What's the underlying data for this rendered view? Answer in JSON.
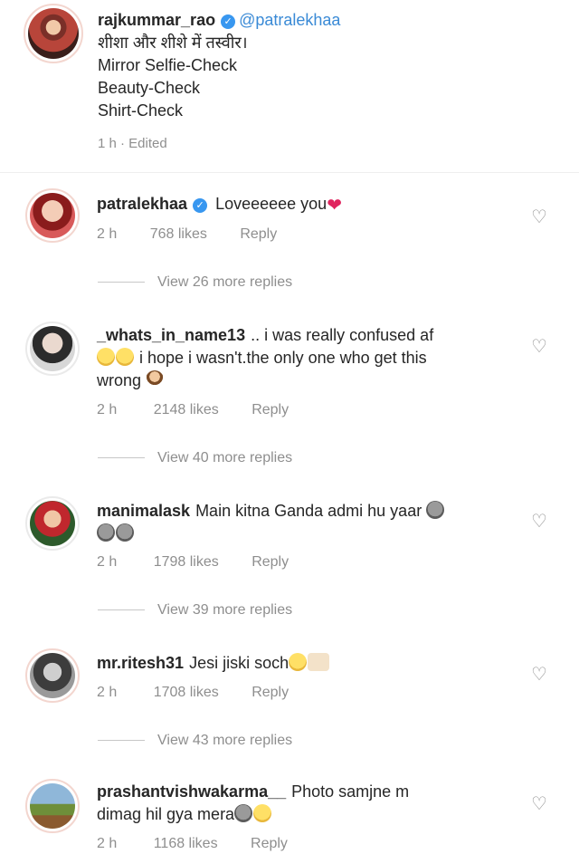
{
  "caption": {
    "username": "rajkummar_rao",
    "mention": "@patralekhaa",
    "lines": [
      "शीशा और शीशे में तस्वीर।",
      "Mirror Selfie-Check",
      "Beauty-Check",
      "Shirt-Check"
    ],
    "meta": "1 h · Edited"
  },
  "comments": [
    {
      "username": "patralekhaa",
      "verified": true,
      "text": "Loveeeeee you",
      "time": "2 h",
      "likes": "768 likes",
      "reply": "Reply",
      "view_replies": "View 26 more replies"
    },
    {
      "username": "_whats_in_name13",
      "text_1": ".. i was really confused af",
      "text_2": "i hope i wasn't.the only one who get this",
      "text_3": "wrong",
      "time": "2 h",
      "likes": "2148 likes",
      "reply": "Reply",
      "view_replies": "View 40 more replies"
    },
    {
      "username": "manimalask",
      "text": "Main kitna Ganda admi hu yaar",
      "time": "2 h",
      "likes": "1798 likes",
      "reply": "Reply",
      "view_replies": "View 39 more replies"
    },
    {
      "username": "mr.ritesh31",
      "text": "Jesi jiski soch",
      "time": "2 h",
      "likes": "1708 likes",
      "reply": "Reply",
      "view_replies": "View 43 more replies"
    },
    {
      "username": "prashantvishwakarma__",
      "text_1": "Photo samjne m",
      "text_2": "dimag hil gya mera",
      "time": "2 h",
      "likes": "1168 likes",
      "reply": "Reply"
    }
  ],
  "icons": {
    "like": "heart-outline-icon",
    "verified": "verified-badge-icon"
  },
  "colors": {
    "mention": "#3a8ad6",
    "meta": "#8e8e8e",
    "verified": "#3897f0"
  }
}
